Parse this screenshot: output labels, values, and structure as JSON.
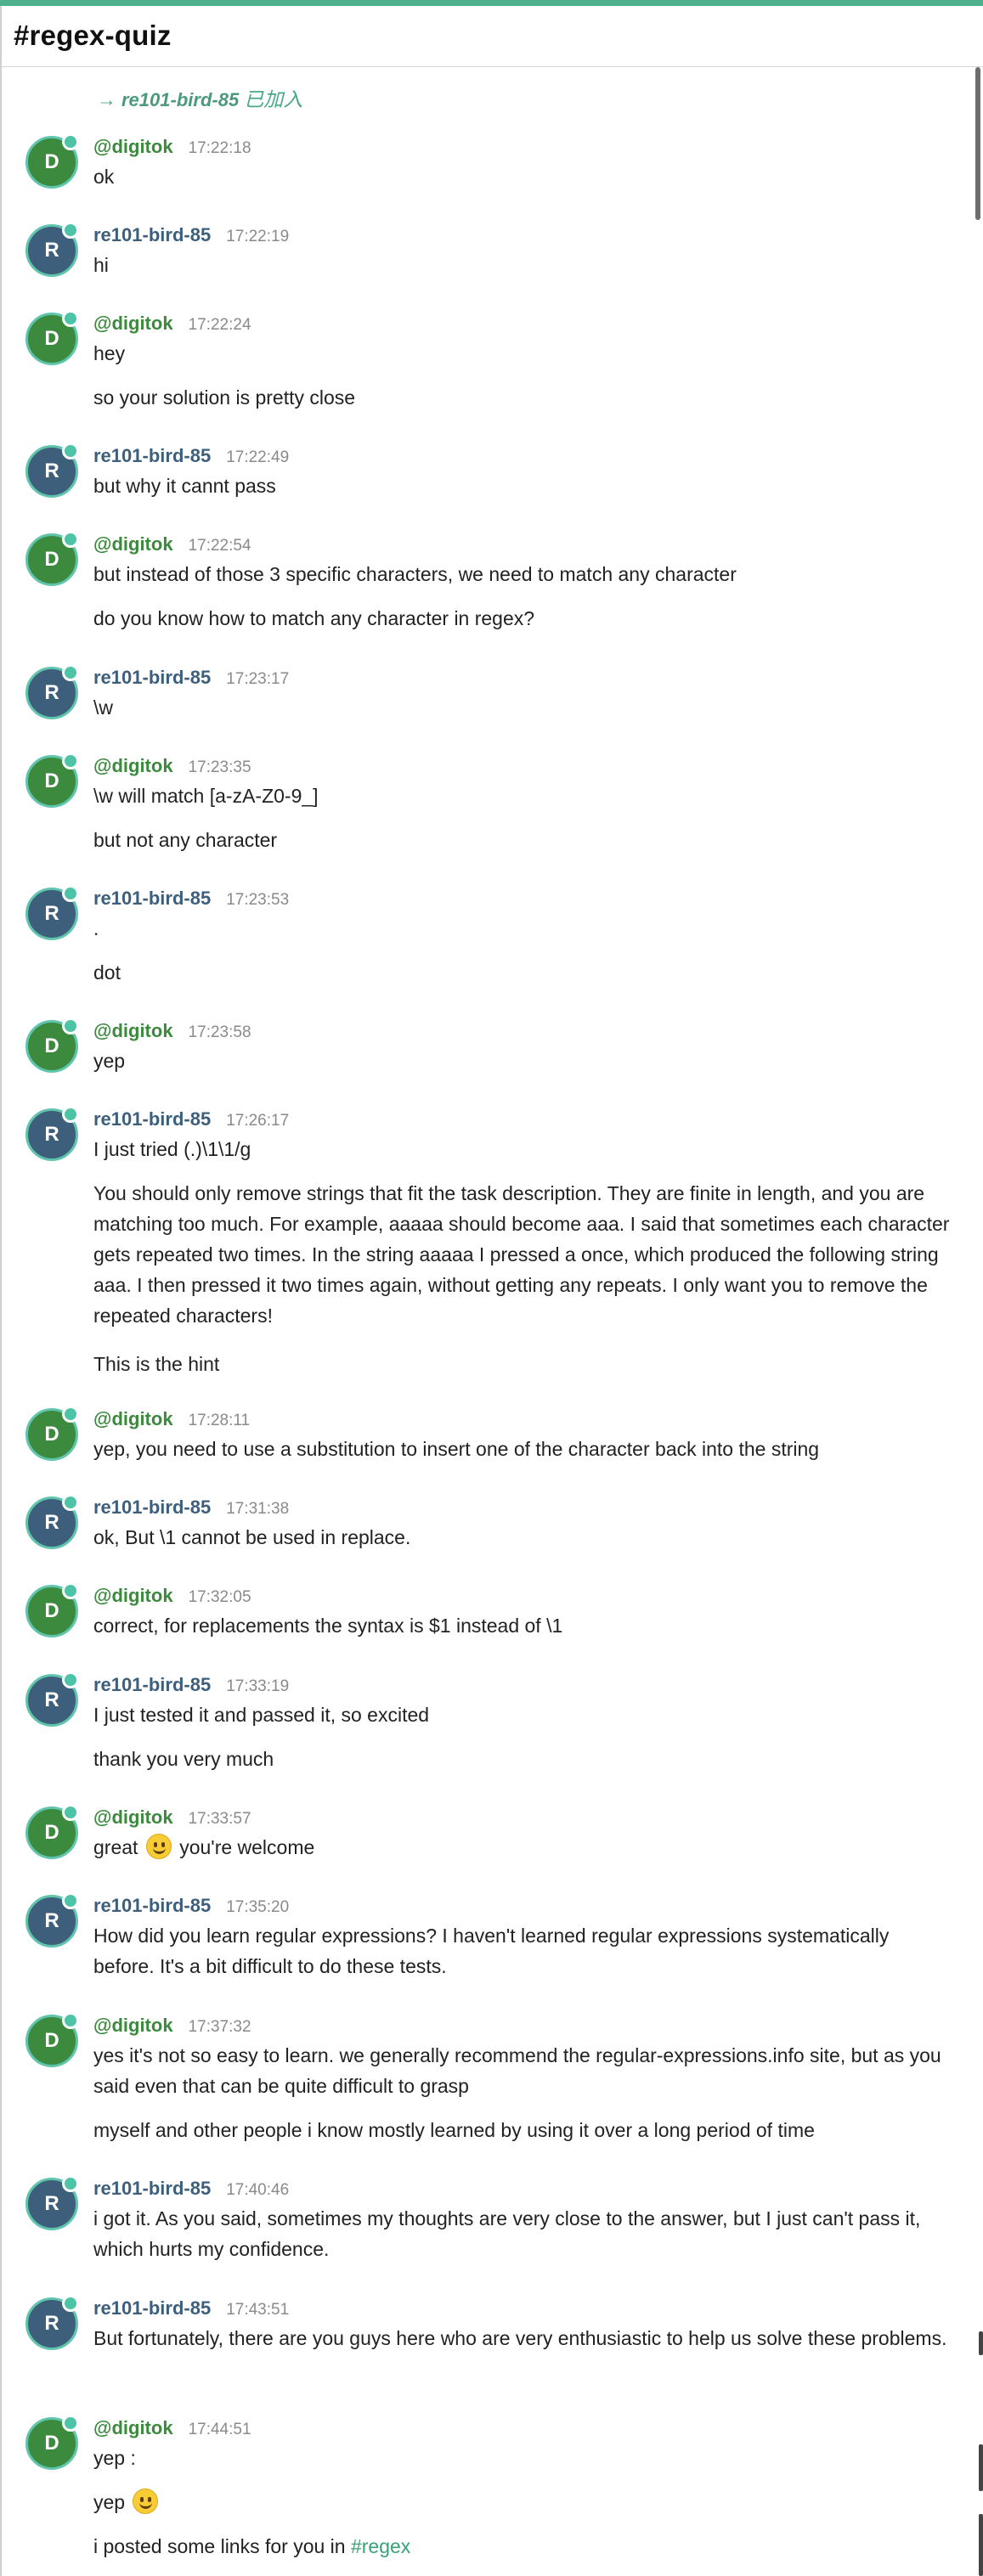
{
  "room": {
    "title": "#regex-quiz"
  },
  "join_notice": {
    "arrow": "→",
    "nick": "re101-bird-85",
    "text": "已加入"
  },
  "users": {
    "digitok": {
      "name": "@digitok",
      "initial": "D",
      "color": "#3c8a3e"
    },
    "bird": {
      "name": "re101-bird-85",
      "initial": "R",
      "color": "#3e5f7c"
    }
  },
  "messages": [
    {
      "time": "17:22:18",
      "lines": [
        "ok"
      ]
    },
    {
      "time": "17:22:19",
      "lines": [
        "hi"
      ]
    },
    {
      "time": "17:22:24",
      "lines": [
        "hey",
        "so your solution is pretty close"
      ]
    },
    {
      "time": "17:22:49",
      "lines": [
        "but why it cannt pass"
      ]
    },
    {
      "time": "17:22:54",
      "lines": [
        "but instead of those 3 specific characters, we need to match any character",
        "do you know how to match any character in regex?"
      ]
    },
    {
      "time": "17:23:17",
      "lines": [
        "\\w"
      ]
    },
    {
      "time": "17:23:35",
      "lines": [
        "\\w will match [a-zA-Z0-9_]",
        "but not any character"
      ]
    },
    {
      "time": "17:23:53",
      "lines": [
        ".",
        "dot"
      ]
    },
    {
      "time": "17:23:58",
      "lines": [
        "yep"
      ]
    },
    {
      "time": "17:26:17",
      "lines": [
        "I just tried (.)\\1\\1/g",
        "You should only remove strings that fit the task description. They are finite in length, and you are matching too much. For example, aaaaa should become aaa. I said that sometimes each character gets repeated two times. In the string aaaaa I pressed a once, which produced the following string aaa. I then pressed it two times again, without getting any repeats. I only want you to remove the repeated characters!",
        "This is the hint"
      ]
    },
    {
      "time": "17:28:11",
      "lines": [
        "yep, you need to use a substitution to insert one of the character back into the string"
      ]
    },
    {
      "time": "17:31:38",
      "lines": [
        "ok, But \\1 cannot be used in replace."
      ]
    },
    {
      "time": "17:32:05",
      "lines": [
        "correct, for replacements the syntax is $1 instead of \\1"
      ]
    },
    {
      "time": "17:33:19",
      "lines": [
        "I just tested it and passed it, so excited",
        "thank you very much"
      ]
    },
    {
      "time": "17:33:57",
      "lines": [
        "great",
        "you're welcome"
      ]
    },
    {
      "time": "17:35:20",
      "lines": [
        "How did you learn regular expressions? I haven't learned regular expressions systematically before. It's a bit difficult to do these tests."
      ]
    },
    {
      "time": "17:37:32",
      "lines": [
        "yes it's not so easy to learn. we generally recommend the regular-expressions.info site, but as you said even that can be quite difficult to grasp",
        "myself and other people i know mostly learned by using it over a long period of time"
      ]
    },
    {
      "time": "17:40:46",
      "lines": [
        "i got it. As you said, sometimes my thoughts are very close to the answer, but I just can't pass it, which hurts my confidence."
      ]
    },
    {
      "time": "17:43:51",
      "lines": [
        "But fortunately, there are you guys here who are very enthusiastic to help us solve these problems."
      ]
    },
    {
      "time": "17:44:51",
      "lines": [
        "yep :",
        "yep",
        "i posted some links for you in",
        "#regex"
      ]
    }
  ]
}
